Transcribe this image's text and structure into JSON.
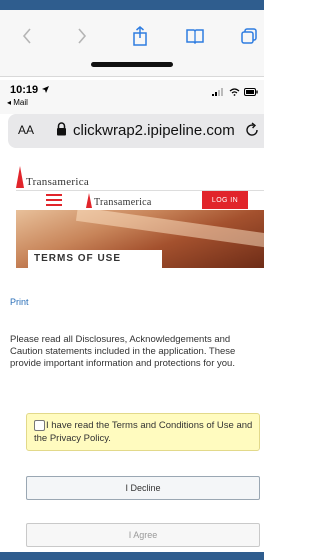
{
  "status_bar": {
    "time": "10:19",
    "back_app": "◂ Mail"
  },
  "toolbar": {
    "icons": [
      "chevron-left-icon",
      "chevron-right-icon",
      "share-icon",
      "bookmarks-icon",
      "tabs-icon"
    ]
  },
  "address_bar": {
    "aa_label": "AA",
    "url": "clickwrap2.ipipeline.com"
  },
  "page": {
    "brand_logo": "Transamerica",
    "site_header": {
      "logo": "Transamerica",
      "login_label": "LOG IN"
    },
    "hero_title": "TERMS OF USE",
    "print_link": "Print",
    "disclaimer": "Please read all Disclosures, Acknowledgements and Caution statements included in the application.  These provide important information and protections for you.",
    "terms_checkbox": {
      "checked": false,
      "label": "I have read the Terms and Conditions of Use and the Privacy Policy."
    },
    "decline_label": "I Decline",
    "agree_label": "I Agree"
  },
  "colors": {
    "brand_red": "#e1252b",
    "link_blue": "#2a6fb8",
    "strip_blue": "#2f5d8e",
    "terms_bg": "#fffbbf"
  }
}
